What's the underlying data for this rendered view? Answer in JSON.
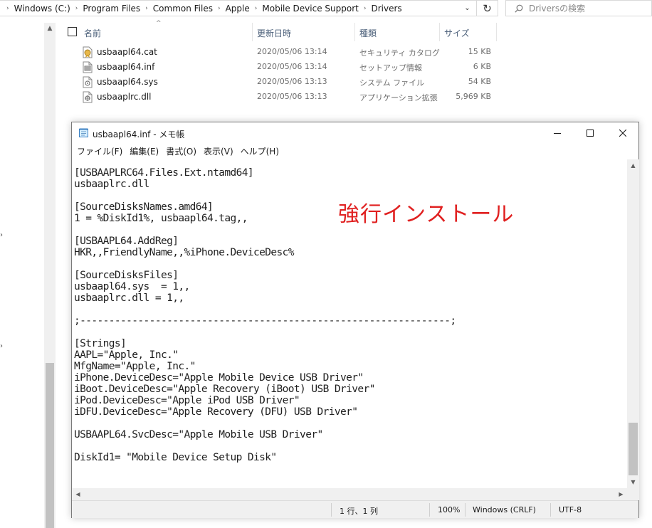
{
  "explorer": {
    "breadcrumbs": [
      "Windows (C:)",
      "Program Files",
      "Common Files",
      "Apple",
      "Mobile Device Support",
      "Drivers"
    ],
    "search_placeholder": "Driversの検索",
    "columns": {
      "name": "名前",
      "date": "更新日時",
      "type": "種類",
      "size": "サイズ"
    },
    "files": [
      {
        "name": "usbaapl64.cat",
        "date": "2020/05/06 13:14",
        "type": "セキュリティ カタログ",
        "size": "15 KB",
        "icon": "catalog-file-icon"
      },
      {
        "name": "usbaapl64.inf",
        "date": "2020/05/06 13:14",
        "type": "セットアップ情報",
        "size": "6 KB",
        "icon": "inf-file-icon"
      },
      {
        "name": "usbaapl64.sys",
        "date": "2020/05/06 13:13",
        "type": "システム ファイル",
        "size": "54 KB",
        "icon": "sys-file-icon"
      },
      {
        "name": "usbaaplrc.dll",
        "date": "2020/05/06 13:13",
        "type": "アプリケーション拡張",
        "size": "5,969 KB",
        "icon": "dll-file-icon"
      }
    ]
  },
  "notepad": {
    "title": "usbaapl64.inf - メモ帳",
    "menu": [
      "ファイル(F)",
      "編集(E)",
      "書式(O)",
      "表示(V)",
      "ヘルプ(H)"
    ],
    "lines": [
      "[USBAAPLRC64.Files.Ext.ntamd64]",
      "usbaaplrc.dll",
      "",
      "[SourceDisksNames.amd64]",
      "1 = %DiskId1%, usbaapl64.tag,,",
      "",
      "[USBAAPL64.AddReg]",
      "HKR,,FriendlyName,,%iPhone.DeviceDesc%",
      "",
      "[SourceDisksFiles]",
      "usbaapl64.sys  = 1,,",
      "usbaaplrc.dll = 1,,",
      "",
      ";----------------------------------------------------------------;",
      "",
      "[Strings]",
      "AAPL=\"Apple, Inc.\"",
      "MfgName=\"Apple, Inc.\"",
      "iPhone.DeviceDesc=\"Apple Mobile Device USB Driver\"",
      "iBoot.DeviceDesc=\"Apple Recovery (iBoot) USB Driver\"",
      "iPod.DeviceDesc=\"Apple iPod USB Driver\"",
      "iDFU.DeviceDesc=\"Apple Recovery (DFU) USB Driver\"",
      "",
      "USBAAPL64.SvcDesc=\"Apple Mobile USB Driver\"",
      "",
      "DiskId1= \"Mobile Device Setup Disk\""
    ],
    "annotation": "強行インストール",
    "annotation_color": "#e02020",
    "status": {
      "position": "1 行、1 列",
      "zoom": "100%",
      "line_ending": "Windows (CRLF)",
      "encoding": "UTF-8"
    }
  }
}
